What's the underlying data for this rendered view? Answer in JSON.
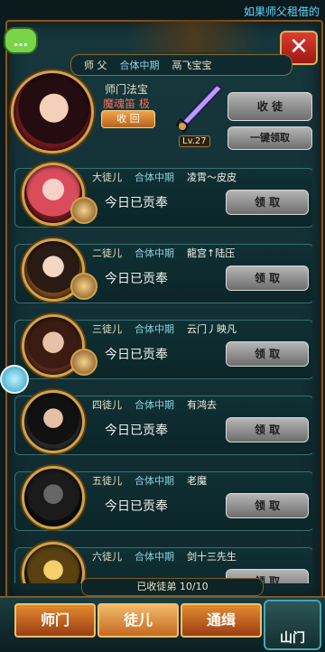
{
  "top_hint": "如果师父租借的",
  "chat_icon": "chat-icon",
  "master_info": {
    "role": "师 父",
    "realm": "合体中期",
    "name": "鬲飞宝宝"
  },
  "treasure": {
    "title": "师门法宝",
    "name": "魔魂笛 极",
    "recall_label": "收 回",
    "level": "Lv.27"
  },
  "actions": {
    "collect_disciple": "收 徒",
    "onekey_claim": "一键领取"
  },
  "disciples": [
    {
      "title": "大徒儿",
      "realm": "合体中期",
      "name": "凌霄～皮皮",
      "status": "今日已贡奉",
      "button": "领 取"
    },
    {
      "title": "二徒儿",
      "realm": "合体中期",
      "name": "龍宫↑陆压",
      "status": "今日已贡奉",
      "button": "领 取"
    },
    {
      "title": "三徒儿",
      "realm": "合体中期",
      "name": "云门丿映凡",
      "status": "今日已贡奉",
      "button": "领 取"
    },
    {
      "title": "四徒儿",
      "realm": "合体中期",
      "name": "有鸿去",
      "status": "今日已贡奉",
      "button": "领 取"
    },
    {
      "title": "五徒儿",
      "realm": "合体中期",
      "name": "老魔",
      "status": "今日已贡奉",
      "button": "领 取"
    },
    {
      "title": "六徒儿",
      "realm": "合体中期",
      "name": "剑十三先生",
      "status": "",
      "button": "领 取"
    }
  ],
  "collected": {
    "label": "已收徒弟",
    "value": "10/10"
  },
  "tabs": [
    {
      "label": "师门"
    },
    {
      "label": "徒儿"
    },
    {
      "label": "通缉"
    }
  ],
  "gate_label": "山门"
}
